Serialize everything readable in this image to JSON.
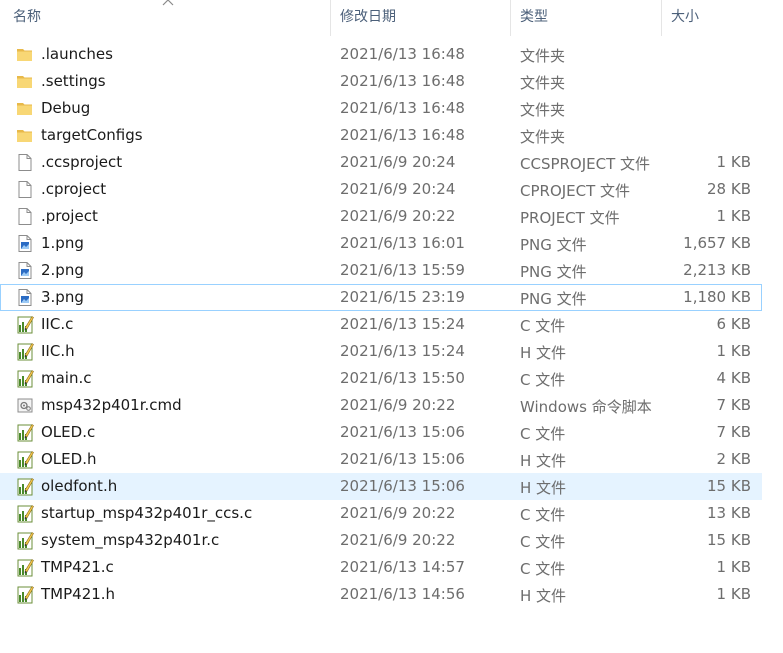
{
  "columns": {
    "name": "名称",
    "date": "修改日期",
    "type": "类型",
    "size": "大小"
  },
  "files": [
    {
      "name": ".launches",
      "date": "2021/6/13 16:48",
      "type": "文件夹",
      "size": "",
      "icon": "folder-icon"
    },
    {
      "name": ".settings",
      "date": "2021/6/13 16:48",
      "type": "文件夹",
      "size": "",
      "icon": "folder-icon"
    },
    {
      "name": "Debug",
      "date": "2021/6/13 16:48",
      "type": "文件夹",
      "size": "",
      "icon": "folder-icon"
    },
    {
      "name": "targetConfigs",
      "date": "2021/6/13 16:48",
      "type": "文件夹",
      "size": "",
      "icon": "folder-icon"
    },
    {
      "name": ".ccsproject",
      "date": "2021/6/9 20:24",
      "type": "CCSPROJECT 文件",
      "size": "1 KB",
      "icon": "blank-file-icon"
    },
    {
      "name": ".cproject",
      "date": "2021/6/9 20:24",
      "type": "CPROJECT 文件",
      "size": "28 KB",
      "icon": "blank-file-icon"
    },
    {
      "name": ".project",
      "date": "2021/6/9 20:22",
      "type": "PROJECT 文件",
      "size": "1 KB",
      "icon": "blank-file-icon"
    },
    {
      "name": "1.png",
      "date": "2021/6/13 16:01",
      "type": "PNG 文件",
      "size": "1,657 KB",
      "icon": "image-file-icon"
    },
    {
      "name": "2.png",
      "date": "2021/6/13 15:59",
      "type": "PNG 文件",
      "size": "2,213 KB",
      "icon": "image-file-icon"
    },
    {
      "name": "3.png",
      "date": "2021/6/15 23:19",
      "type": "PNG 文件",
      "size": "1,180 KB",
      "icon": "image-file-icon"
    },
    {
      "name": "IIC.c",
      "date": "2021/6/13 15:24",
      "type": "C 文件",
      "size": "6 KB",
      "icon": "source-file-icon"
    },
    {
      "name": "IIC.h",
      "date": "2021/6/13 15:24",
      "type": "H 文件",
      "size": "1 KB",
      "icon": "source-file-icon"
    },
    {
      "name": "main.c",
      "date": "2021/6/13 15:50",
      "type": "C 文件",
      "size": "4 KB",
      "icon": "source-file-icon"
    },
    {
      "name": "msp432p401r.cmd",
      "date": "2021/6/9 20:22",
      "type": "Windows 命令脚本",
      "size": "7 KB",
      "icon": "script-file-icon"
    },
    {
      "name": "OLED.c",
      "date": "2021/6/13 15:06",
      "type": "C 文件",
      "size": "7 KB",
      "icon": "source-file-icon"
    },
    {
      "name": "OLED.h",
      "date": "2021/6/13 15:06",
      "type": "H 文件",
      "size": "2 KB",
      "icon": "source-file-icon"
    },
    {
      "name": "oledfont.h",
      "date": "2021/6/13 15:06",
      "type": "H 文件",
      "size": "15 KB",
      "icon": "source-file-icon"
    },
    {
      "name": "startup_msp432p401r_ccs.c",
      "date": "2021/6/9 20:22",
      "type": "C 文件",
      "size": "13 KB",
      "icon": "source-file-icon"
    },
    {
      "name": "system_msp432p401r.c",
      "date": "2021/6/9 20:22",
      "type": "C 文件",
      "size": "15 KB",
      "icon": "source-file-icon"
    },
    {
      "name": "TMP421.c",
      "date": "2021/6/13 14:57",
      "type": "C 文件",
      "size": "1 KB",
      "icon": "source-file-icon"
    },
    {
      "name": "TMP421.h",
      "date": "2021/6/13 14:56",
      "type": "H 文件",
      "size": "1 KB",
      "icon": "source-file-icon"
    }
  ],
  "focused_row": 9,
  "hover_row": 16,
  "colors": {
    "header_text": "#4c607a",
    "secondary_text": "#6d6d6d",
    "hover_bg": "#e5f3ff",
    "focus_border": "#99d1ff",
    "folder": "#f8d775"
  }
}
